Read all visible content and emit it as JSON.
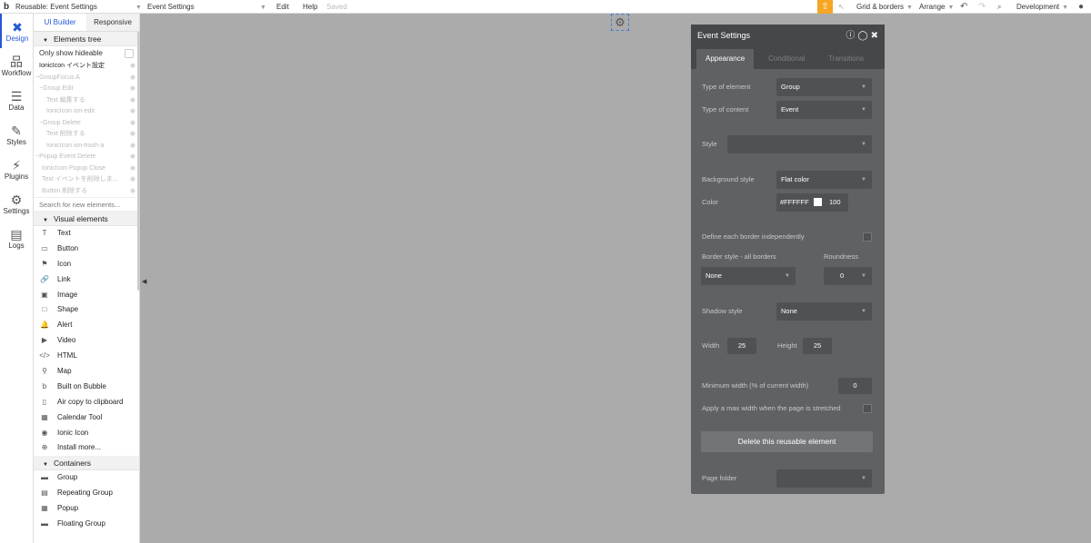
{
  "topbar": {
    "page_name": "Reusable: Event Settings",
    "element_select": "Event Settings",
    "menu_edit": "Edit",
    "menu_help": "Help",
    "saved_status": "Saved",
    "grid_borders": "Grid & borders",
    "arrange": "Arrange",
    "development": "Development"
  },
  "leftnav": {
    "items": [
      {
        "label": "Design"
      },
      {
        "label": "Workflow"
      },
      {
        "label": "Data"
      },
      {
        "label": "Styles"
      },
      {
        "label": "Plugins"
      },
      {
        "label": "Settings"
      },
      {
        "label": "Logs"
      }
    ]
  },
  "panel": {
    "tab_ui_builder": "UI Builder",
    "tab_responsive": "Responsive",
    "elements_tree_title": "Elements tree",
    "only_show_hideable": "Only show hideable",
    "tree": [
      "IonicIcon イベント設定",
      "−GroupFocus A",
      "−Group Edit",
      "Text 編集する",
      "IonicIcon ion-edit",
      "−Group Delete",
      "Text 削除する",
      "IonicIcon ion-trash-a",
      "−Popup Event Delete",
      "IonicIcon Popup Close",
      "Text イベントを削除しま...",
      "Button 削除する"
    ],
    "search_placeholder": "Search for new elements...",
    "visual_title": "Visual elements",
    "visual": [
      "Text",
      "Button",
      "Icon",
      "Link",
      "Image",
      "Shape",
      "Alert",
      "Video",
      "HTML",
      "Map",
      "Built on Bubble",
      "Air copy to clipboard",
      "Calendar Tool",
      "Ionic Icon",
      "Install more..."
    ],
    "containers_title": "Containers",
    "containers": [
      "Group",
      "Repeating Group",
      "Popup",
      "Floating Group"
    ]
  },
  "dialog": {
    "title": "Event Settings",
    "tab_appearance": "Appearance",
    "tab_conditional": "Conditional",
    "tab_transitions": "Transitions",
    "type_of_element_label": "Type of element",
    "type_of_element_value": "Group",
    "type_of_content_label": "Type of content",
    "type_of_content_value": "Event",
    "style_label": "Style",
    "background_style_label": "Background style",
    "background_style_value": "Flat color",
    "color_label": "Color",
    "color_hex": "#FFFFFF",
    "color_opacity": "100",
    "define_border_label": "Define each border independently",
    "border_style_label": "Border style - all borders",
    "roundness_label": "Roundness",
    "border_style_value": "None",
    "roundness_value": "0",
    "shadow_style_label": "Shadow style",
    "shadow_style_value": "None",
    "width_label": "Width",
    "width_value": "25",
    "height_label": "Height",
    "height_value": "25",
    "min_width_label": "Minimum width (% of current width)",
    "min_width_value": "0",
    "max_width_label": "Apply a max width when the page is stretched",
    "delete_button": "Delete this reusable element",
    "page_folder_label": "Page folder"
  },
  "colors": {
    "accent": "#2457d6",
    "toolbar_highlight": "#f5a623",
    "dialog_bg": "#5f6164"
  }
}
